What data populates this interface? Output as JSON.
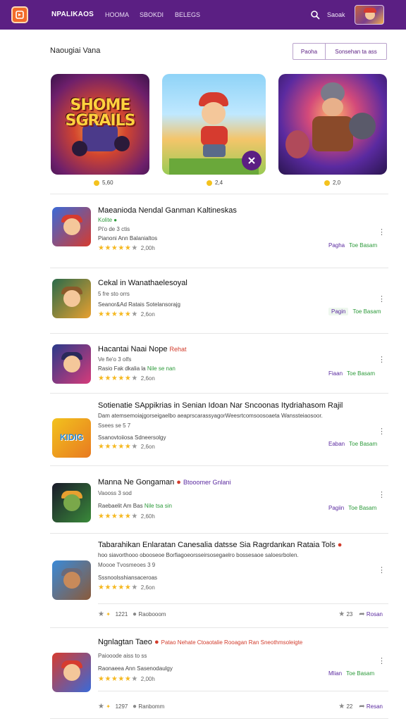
{
  "header": {
    "brand": "NPALIKAOS",
    "nav": [
      "HOOMA",
      "SBOKDI",
      "BELEGS"
    ],
    "search_label": "Saoak"
  },
  "section": {
    "title": "Naougiai Vana",
    "buttons": [
      "Paoha",
      "Sonsehan ta ass"
    ]
  },
  "featured": [
    {
      "art_text": "SHOME SGRAILS",
      "rating": "5,60"
    },
    {
      "art_text": "",
      "rating": "2,4"
    },
    {
      "art_text": "",
      "rating": "2,0"
    }
  ],
  "items": [
    {
      "title": "Maeanioda Nendal Ganman Kaltineskas",
      "badge": "Kolite",
      "sub": "Pi'o de 3 ctis",
      "desc": "Pianoni Ann Balanialtos",
      "rating_count": "2,00h",
      "action1": "Pagha",
      "action2": "Toe Basam"
    },
    {
      "title": "Cekal in Wanathaelesoyal",
      "badge": "",
      "sub": "5 fre sto orrs",
      "desc": "Seanor&Ad Ratais Sotelansorajg",
      "rating_count": "2,6on",
      "action1": "Pagin",
      "action2": "Toe Basam"
    },
    {
      "title": "Hacantai Naai Nope",
      "badge": "Rehat",
      "sub": "Ve fie'o 3 olfs",
      "desc": "Rasio Fak dkalia la",
      "desc_badge": "Nile se nan",
      "rating_count": "2,6on",
      "action1": "Fiaan",
      "action2": "Toe Basam"
    },
    {
      "title": "Sotienatie SAppikrias in Senian Idoan Nar Sncoonas Itydriahasom Rajil",
      "badge": "",
      "long_desc": "Dam atemsemoiajgorseigaelbo aeaprscarassyagorWeesrtcomsoosoaeta Wanssteiaosoor.",
      "sub": "Ssees se 5 7",
      "desc": "Ssanovtoiiosa Sdneersolgy",
      "rating_count": "2,6on",
      "action1": "Eaban",
      "action2": "Toe Basam"
    },
    {
      "title": "Manna Ne Gongaman",
      "badge": "Btooomer Gnlani",
      "sub": "Vaooss 3 sod",
      "desc": "Raebaelit Am Bas",
      "desc_badge": "Nile tsa sin",
      "rating_count": "2,60h",
      "action1": "Pagiin",
      "action2": "Toe Basam"
    },
    {
      "title": "Tabarahikan Enlaratan Canesalia datsse Sia Ragrdankan Rataia Tols",
      "badge": "",
      "long_desc": "hoo siavorthooo obooseoe Borfiagoeorsseirsosegaelro bossesaoe saloesrbolen.",
      "sub": "Moooe Tvosmeoes 3 9",
      "desc": "Sssnoolsshiansaceroas",
      "rating_count": "2,6on",
      "stats_left": [
        "1221",
        "Raobooom"
      ],
      "stats_right": [
        "23",
        "Rosan"
      ]
    },
    {
      "title": "Ngnlagtan Taeo",
      "badge": "Patao Nehate Ctoaotalie Rooagan Ran Sneothmsoleigte",
      "sub": "Paiooode aiss to ss",
      "desc": "Raonaeea Ann Sasenodaulgy",
      "rating_count": "2,00h",
      "action1": "Mlian",
      "action2": "Toe Basam",
      "stats_left": [
        "1297",
        "Ranbomm"
      ],
      "stats_right": [
        "22",
        "Resan"
      ]
    }
  ],
  "colors": {
    "header_bg": "#5b1f83",
    "accent": "#5b2aa0",
    "star": "#f5b820",
    "green": "#2c9a3a",
    "red": "#d23c2c"
  }
}
